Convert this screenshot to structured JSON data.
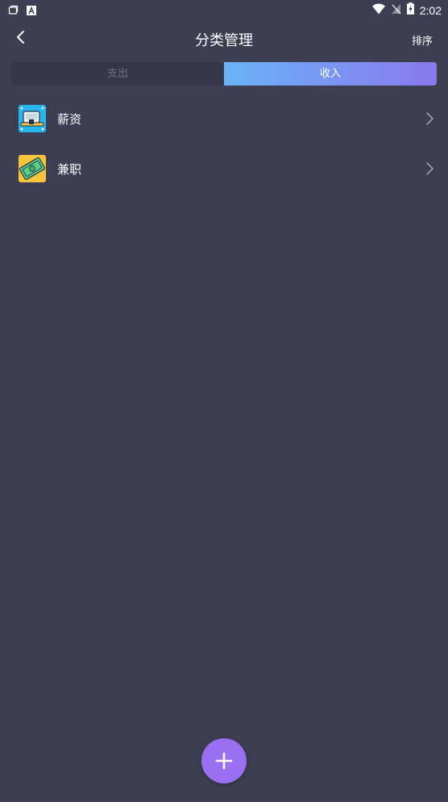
{
  "status_bar": {
    "time": "2:02",
    "icons": [
      "app-notification-icon",
      "a-notification-icon",
      "wifi-icon",
      "no-signal-icon",
      "battery-charging-icon"
    ]
  },
  "header": {
    "title": "分类管理",
    "sort_label": "排序",
    "back_icon": "chevron-left-icon"
  },
  "tabs": [
    {
      "label": "支出",
      "active": false
    },
    {
      "label": "收入",
      "active": true
    }
  ],
  "categories": [
    {
      "label": "薪资",
      "icon": "salary-icon"
    },
    {
      "label": "兼职",
      "icon": "part-time-money-icon"
    }
  ],
  "fab": {
    "icon": "plus-icon"
  },
  "colors": {
    "background": "#3d3e52",
    "tab_inactive": "#363748",
    "tab_gradient_start": "#6ab3f6",
    "tab_gradient_end": "#8a79ee",
    "fab": "#9a6ff1"
  }
}
